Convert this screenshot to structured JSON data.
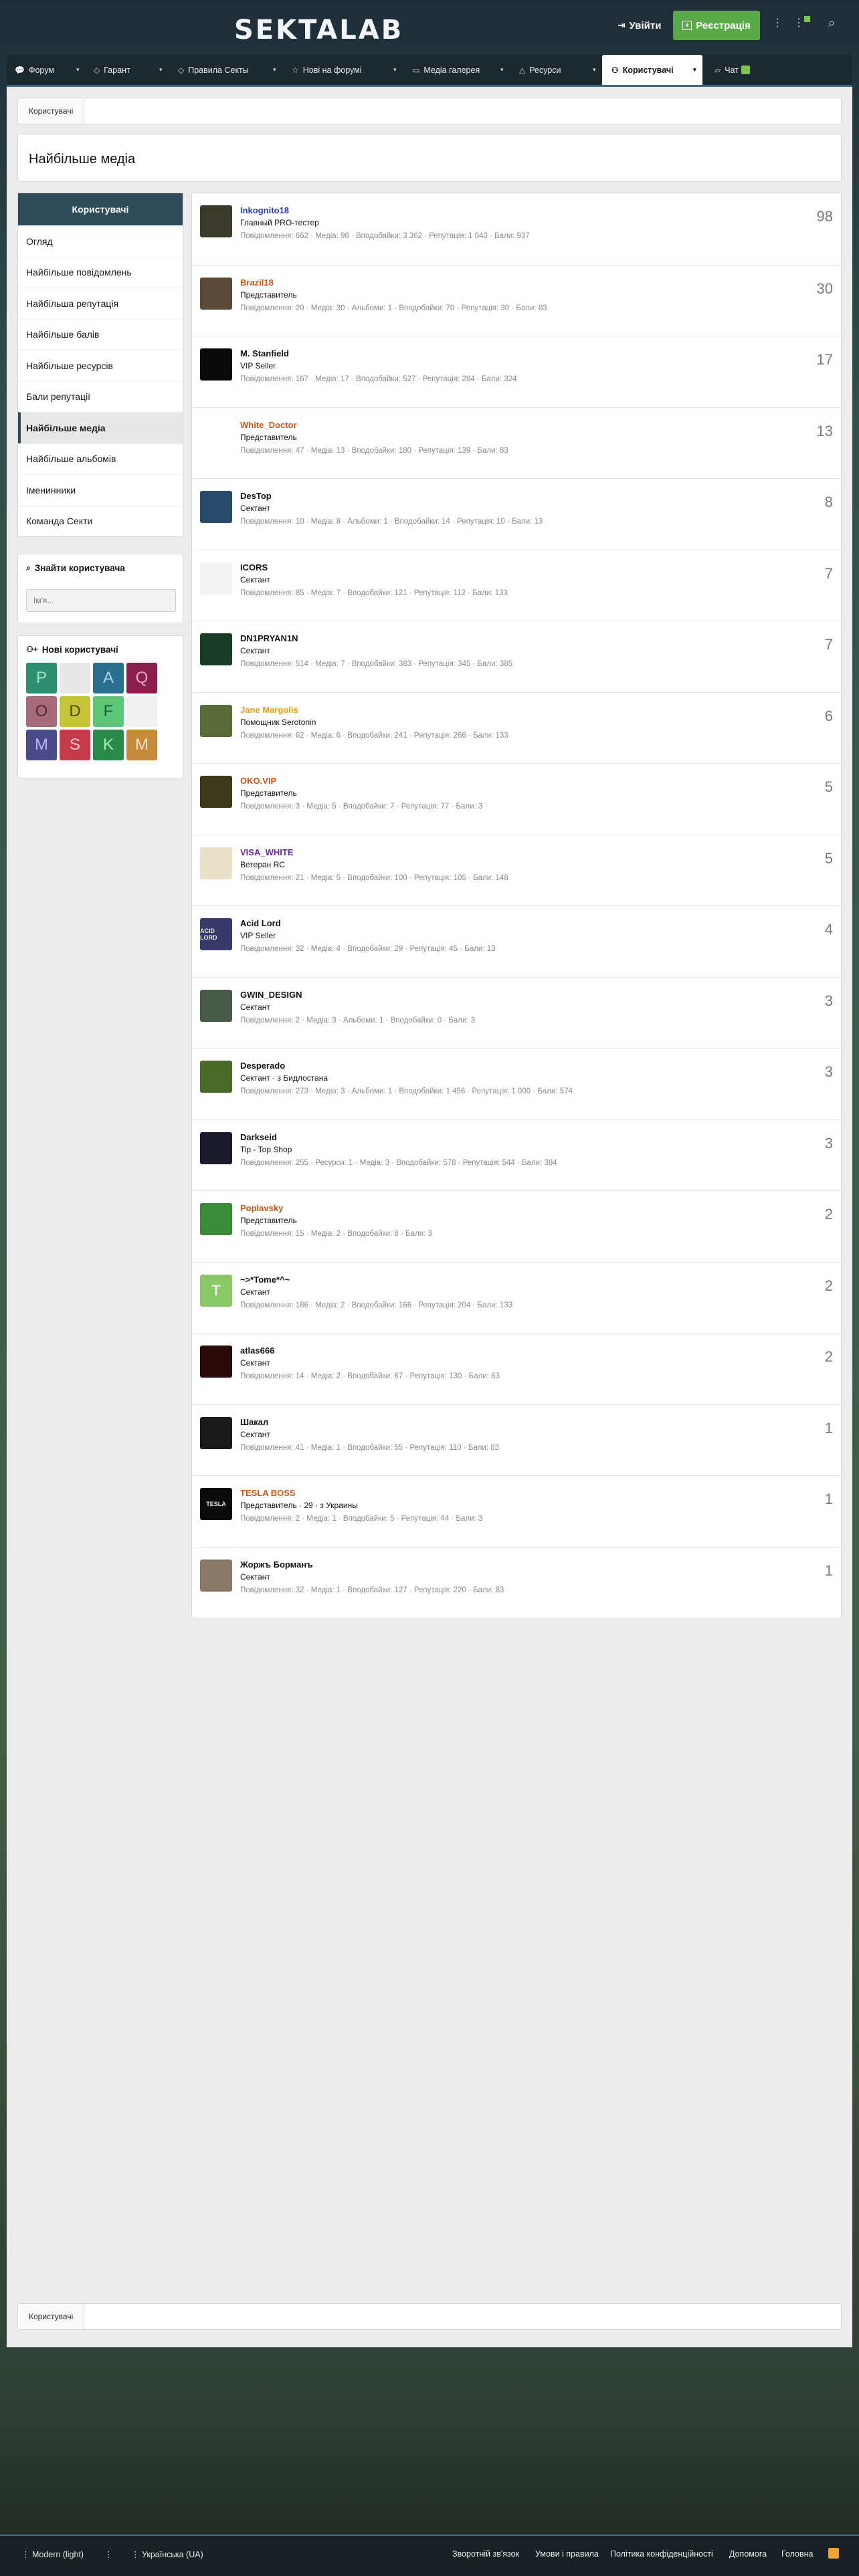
{
  "header": {
    "logo": "SEKTALAB",
    "login_label": "Увійти",
    "register_label": "Реєстрація"
  },
  "nav": {
    "items": [
      {
        "label": "Форум",
        "icon": "chat-bubbles-icon"
      },
      {
        "label": "Гарант",
        "icon": "tag-icon"
      },
      {
        "label": "Правила Секты",
        "icon": "tags-icon"
      },
      {
        "label": "Нові на форумі",
        "icon": "star-icon"
      },
      {
        "label": "Медіа галерея",
        "icon": "image-icon"
      },
      {
        "label": "Ресурси",
        "icon": "warning-icon"
      },
      {
        "label": "Користувачі",
        "icon": "user-icon"
      },
      {
        "label": "Чат",
        "icon": "chat-icon"
      }
    ]
  },
  "breadcrumb": {
    "label": "Користувачі"
  },
  "page_title": "Найбільше медіа",
  "sidenav": {
    "header": "Користувачі",
    "items": [
      "Огляд",
      "Найбільше повідомлень",
      "Найбільша репутація",
      "Найбільше балів",
      "Найбільше ресурсів",
      "Бали репутації",
      "Найбільше медіа",
      "Найбільше альбомів",
      "Іменинники",
      "Команда Секти"
    ],
    "active_index": 6
  },
  "find_user": {
    "title": "Знайти користувача",
    "placeholder": "Ім'я..."
  },
  "new_users": {
    "title": "Нові користувачі",
    "avatars": [
      {
        "letter": "P",
        "bg": "#2d8f6f",
        "fg": "#9ee6c8"
      },
      {
        "letter": "",
        "bg": "#e8e8e8",
        "fg": "#000000"
      },
      {
        "letter": "A",
        "bg": "#2a6f8f",
        "fg": "#a8d8ee"
      },
      {
        "letter": "Q",
        "bg": "#8a1f4a",
        "fg": "#e8a8c4"
      },
      {
        "letter": "O",
        "bg": "#a86a7a",
        "fg": "#4a2a32"
      },
      {
        "letter": "D",
        "bg": "#c4c43a",
        "fg": "#4a4a10"
      },
      {
        "letter": "F",
        "bg": "#5ac878",
        "fg": "#1f5a30"
      },
      {
        "letter": "",
        "bg": "#f0f0f0",
        "fg": "#000000"
      },
      {
        "letter": "M",
        "bg": "#4a4a8a",
        "fg": "#b8b8ee"
      },
      {
        "letter": "S",
        "bg": "#c43a4a",
        "fg": "#f8c4c8"
      },
      {
        "letter": "K",
        "bg": "#2a8a4a",
        "fg": "#a8eec0"
      },
      {
        "letter": "M",
        "bg": "#c48a3a",
        "fg": "#f8e4c0"
      }
    ]
  },
  "labels": {
    "posts": "Повідомлення",
    "media": "Медіа",
    "albums": "Альбоми",
    "reactions": "Вподобайки",
    "reputation": "Репутація",
    "points": "Бали",
    "resources": "Ресурси"
  },
  "members": [
    {
      "name": "Inkognito18",
      "color": "#2a3db8",
      "title": "Главный PRO-тестер",
      "stats": "Повідомлення: 662 · Медіа: 98 · Вподобайки: 3 362 · Репутація: 1 040 · Бали: 937",
      "count": "98",
      "avatar_bg": "#3a3a2a",
      "avatar_text": ""
    },
    {
      "name": "Brazil18",
      "color": "#c8581a",
      "title": "Представитель",
      "stats": "Повідомлення: 20 · Медіа: 30 · Альбоми: 1 · Вподобайки: 70 · Репутація: 30 · Бали: 83",
      "count": "30",
      "avatar_bg": "#5a4a3a",
      "avatar_text": ""
    },
    {
      "name": "M. Stanfield",
      "color": "#141414",
      "title": "VIP Seller",
      "stats": "Повідомлення: 167 · Медіа: 17 · Вподобайки: 527 · Репутація: 284 · Бали: 324",
      "count": "17",
      "avatar_bg": "#0a0a0a",
      "avatar_text": ""
    },
    {
      "name": "White_Doctor",
      "color": "#c8581a",
      "title": "Представитель",
      "stats": "Повідомлення: 47 · Медіа: 13 · Вподобайки: 180 · Репутація: 139 · Бали: 83",
      "count": "13",
      "avatar_bg": "#ffffff",
      "avatar_text": ""
    },
    {
      "name": "DesTop",
      "color": "#141414",
      "title": "Сектант",
      "stats": "Повідомлення: 10 · Медіа: 8 · Альбоми: 1 · Вподобайки: 14 · Репутація: 10 · Бали: 13",
      "count": "8",
      "avatar_bg": "#2a4a6a",
      "avatar_text": ""
    },
    {
      "name": "ICORS",
      "color": "#141414",
      "title": "Сектант",
      "stats": "Повідомлення: 85 · Медіа: 7 · Вподобайки: 121 · Репутація: 112 · Бали: 133",
      "count": "7",
      "avatar_bg": "#f2f2f2",
      "avatar_text": ""
    },
    {
      "name": "DN1PRYAN1N",
      "color": "#141414",
      "title": "Сектант",
      "stats": "Повідомлення: 514 · Медіа: 7 · Вподобайки: 383 · Репутація: 345 · Бали: 385",
      "count": "7",
      "avatar_bg": "#1a3a2a",
      "avatar_text": ""
    },
    {
      "name": "Jane Margolis",
      "color": "#e0a11a",
      "title": "Помощник Serotonin",
      "stats": "Повідомлення: 62 · Медіа: 6 · Вподобайки: 241 · Репутація: 266 · Бали: 133",
      "count": "6",
      "avatar_bg": "#5a6a3a",
      "avatar_text": ""
    },
    {
      "name": "OKO.VIP",
      "color": "#c8581a",
      "title": "Представитель",
      "stats": "Повідомлення: 3 · Медіа: 5 · Вподобайки: 7 · Репутація: 77 · Бали: 3",
      "count": "5",
      "avatar_bg": "#3a3a1a",
      "avatar_text": ""
    },
    {
      "name": "VISA_WHITE",
      "color": "#6a2a9a",
      "title": "Ветеран RC",
      "stats": "Повідомлення: 21 · Медіа: 5 · Вподобайки: 100 · Репутація: 105 · Бали: 148",
      "count": "5",
      "avatar_bg": "#e8e0c8",
      "avatar_text": ""
    },
    {
      "name": "Acid Lord",
      "color": "#141414",
      "title": "VIP Seller",
      "stats": "Повідомлення: 32 · Медіа: 4 · Вподобайки: 29 · Репутація: 45 · Бали: 13",
      "count": "4",
      "avatar_bg": "#3a3a6a",
      "avatar_text": "ACID LORD"
    },
    {
      "name": "GWIN_DESIGN",
      "color": "#141414",
      "title": "Сектант",
      "stats": "Повідомлення: 2 · Медіа: 3 · Альбоми: 1 · Вподобайки: 0 · Бали: 3",
      "count": "3",
      "avatar_bg": "#4a5a4a",
      "avatar_text": ""
    },
    {
      "name": "Desperado",
      "color": "#141414",
      "title": "Сектант · з Бидлостана",
      "stats": "Повідомлення: 273 · Медіа: 3 · Альбоми: 1 · Вподобайки: 1 456 · Репутація: 1 000 · Бали: 574",
      "count": "3",
      "avatar_bg": "#4a6a2a",
      "avatar_text": ""
    },
    {
      "name": "Darkseid",
      "color": "#141414",
      "title": "Tip - Top Shop",
      "stats": "Повідомлення: 255 · Ресурси: 1 · Медіа: 3 · Вподобайки: 578 · Репутація: 544 · Бали: 384",
      "count": "3",
      "avatar_bg": "#1a1a2a",
      "avatar_text": ""
    },
    {
      "name": "Poplavsky",
      "color": "#c8581a",
      "title": "Представитель",
      "stats": "Повідомлення: 15 · Медіа: 2 · Вподобайки: 8 · Бали: 3",
      "count": "2",
      "avatar_bg": "#3a8a3a",
      "avatar_text": ""
    },
    {
      "name": "~>*Tome*^~",
      "color": "#141414",
      "title": "Сектант",
      "stats": "Повідомлення: 186 · Медіа: 2 · Вподобайки: 166 · Репутація: 204 · Бали: 133",
      "count": "2",
      "avatar_bg": "#8ac868",
      "avatar_text": "T"
    },
    {
      "name": "atlas666",
      "color": "#141414",
      "title": "Сектант",
      "stats": "Повідомлення: 14 · Медіа: 2 · Вподобайки: 67 · Репутація: 130 · Бали: 63",
      "count": "2",
      "avatar_bg": "#2a0a0a",
      "avatar_text": ""
    },
    {
      "name": "Шакал",
      "color": "#141414",
      "title": "Сектант",
      "stats": "Повідомлення: 41 · Медіа: 1 · Вподобайки: 55 · Репутація: 110 · Бали: 83",
      "count": "1",
      "avatar_bg": "#1a1a1a",
      "avatar_text": ""
    },
    {
      "name": "TESLA BOSS",
      "color": "#c8581a",
      "title": "Представитель · 29 · з Украины",
      "stats": "Повідомлення: 2 · Медіа: 1 · Вподобайки: 5 · Репутація: 44 · Бали: 3",
      "count": "1",
      "avatar_bg": "#0a0a0a",
      "avatar_text": "TESLA"
    },
    {
      "name": "Жоржъ Борманъ",
      "color": "#141414",
      "title": "Сектант",
      "stats": "Повідомлення: 32 · Медіа: 1 · Вподобайки: 127 · Репутація: 220 · Бали: 83",
      "count": "1",
      "avatar_bg": "#8a7a6a",
      "avatar_text": ""
    }
  ],
  "bottom_breadcrumb": {
    "label": "Користувачі"
  },
  "footer": {
    "style_label": "Modern (light)",
    "language_label": "Українська (UA)",
    "links": [
      "Зворотній зв'язок",
      "Умови і правила",
      "Політика конфіденційності",
      "Допомога",
      "Головна"
    ]
  }
}
